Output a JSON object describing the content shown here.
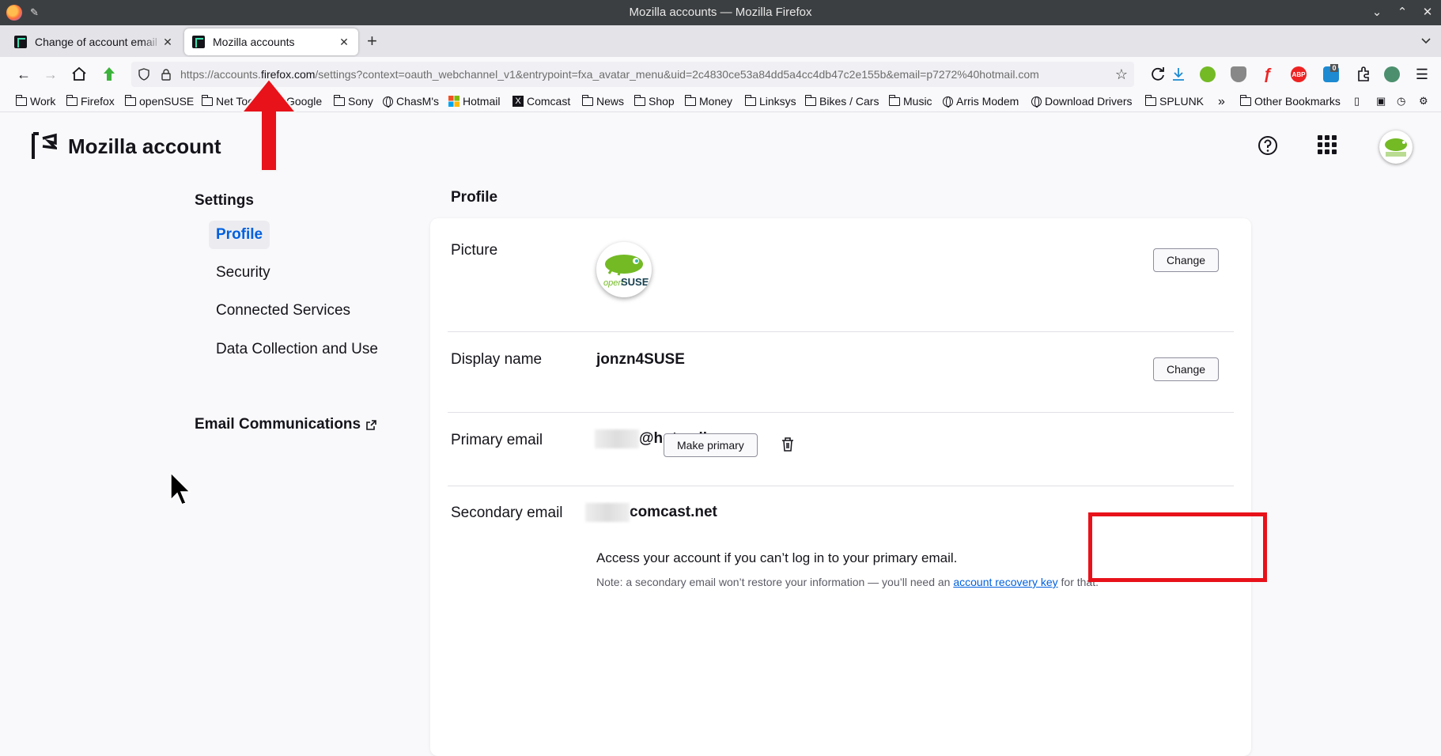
{
  "window": {
    "title": "Mozilla accounts — Mozilla Firefox"
  },
  "tabs": [
    {
      "label": "Change of account email a",
      "active": false
    },
    {
      "label": "Mozilla accounts",
      "active": true
    }
  ],
  "url": {
    "prefix": "https://accounts.",
    "host": "firefox.com",
    "path": "/settings?context=oauth_webchannel_v1&entrypoint=fxa_avatar_menu&uid=2c4830ce53a84dd5a4cc4db47c2e155b&email=p7272%40hotmail.com"
  },
  "bookmarks": [
    {
      "label": "Work",
      "icon": "folder"
    },
    {
      "label": "Firefox",
      "icon": "folder"
    },
    {
      "label": "openSUSE",
      "icon": "folder"
    },
    {
      "label": "Net Too",
      "icon": "folder"
    },
    {
      "label": "Google",
      "icon": "folder"
    },
    {
      "label": "Sony",
      "icon": "folder"
    },
    {
      "label": "ChasM's",
      "icon": "globe"
    },
    {
      "label": "Hotmail",
      "icon": "windows"
    },
    {
      "label": "Comcast",
      "icon": "x"
    },
    {
      "label": "News",
      "icon": "folder"
    },
    {
      "label": "Shop",
      "icon": "folder"
    },
    {
      "label": "Money",
      "icon": "folder"
    },
    {
      "label": "Linksys",
      "icon": "folder"
    },
    {
      "label": "Bikes / Cars",
      "icon": "folder"
    },
    {
      "label": "Music",
      "icon": "folder"
    },
    {
      "label": "Arris Modem",
      "icon": "globe"
    },
    {
      "label": "Download Drivers",
      "icon": "globe"
    },
    {
      "label": "SPLUNK",
      "icon": "folder"
    }
  ],
  "bookmarks_other": "Other Bookmarks",
  "extension_badge": "0",
  "extension_abp": "ABP",
  "header": {
    "title": "Mozilla account"
  },
  "sidebar": {
    "heading": "Settings",
    "items": [
      {
        "label": "Profile",
        "active": true
      },
      {
        "label": "Security",
        "active": false
      },
      {
        "label": "Connected Services",
        "active": false
      },
      {
        "label": "Data Collection and Use",
        "active": false
      }
    ],
    "email_comms": "Email Communications"
  },
  "profile": {
    "title": "Profile",
    "picture_label": "Picture",
    "picture_text_open": "open",
    "picture_text_suse": "SUSE",
    "change_label": "Change",
    "display_name_label": "Display name",
    "display_name": "jonzn4SUSE",
    "primary_email_label": "Primary email",
    "primary_email_visible": "@hotmail.com",
    "secondary_email_label": "Secondary email",
    "secondary_email_visible": "comcast.net",
    "make_primary_label": "Make primary",
    "secondary_desc": "Access your account if you can’t log in to your primary email.",
    "note_before": "Note: a secondary email won’t restore your information — you’ll need an ",
    "note_link": "account recovery key",
    "note_after": " for that."
  },
  "colors": {
    "accent": "#0060df",
    "annotation_red": "#e8121a",
    "suse_green": "#73ba25"
  }
}
